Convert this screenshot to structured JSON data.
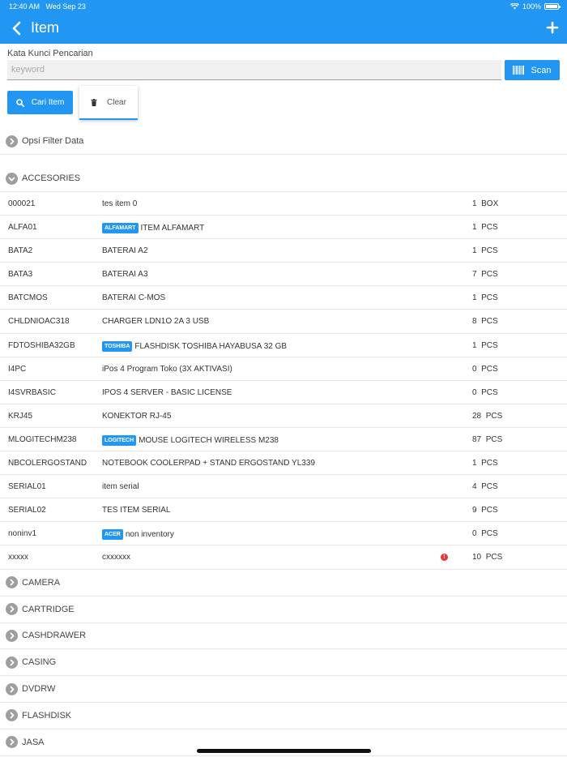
{
  "status_bar": {
    "time": "12:40 AM",
    "date": "Wed Sep 23",
    "battery": "100%",
    "battery_level": 1.0
  },
  "header": {
    "title": "Item",
    "back_icon": "chevron-left-icon",
    "add_icon": "plus-icon"
  },
  "search": {
    "label": "Kata Kunci Pencarian",
    "placeholder": "keyword",
    "value": "",
    "scan_label": "Scan"
  },
  "actions": {
    "search_label": "Cari Item",
    "clear_label": "Clear"
  },
  "filter": {
    "label": "Opsi Filter Data"
  },
  "expanded_group": {
    "name": "ACCESORIES",
    "items": [
      {
        "code": "000021",
        "brand": "",
        "name": "tes item 0",
        "qty": "1",
        "unit": "BOX",
        "warning": false
      },
      {
        "code": "ALFA01",
        "brand": "ALFAMART",
        "name": "ITEM ALFAMART",
        "qty": "1",
        "unit": "PCS",
        "warning": false
      },
      {
        "code": "BATA2",
        "brand": "",
        "name": "BATERAI A2",
        "qty": "1",
        "unit": "PCS",
        "warning": false
      },
      {
        "code": "BATA3",
        "brand": "",
        "name": "BATERAI A3",
        "qty": "7",
        "unit": "PCS",
        "warning": false
      },
      {
        "code": "BATCMOS",
        "brand": "",
        "name": "BATERAI C-MOS",
        "qty": "1",
        "unit": "PCS",
        "warning": false
      },
      {
        "code": "CHLDNIOAC318",
        "brand": "",
        "name": "CHARGER LDN1O 2A 3 USB",
        "qty": "8",
        "unit": "PCS",
        "warning": false
      },
      {
        "code": "FDTOSHIBA32GB",
        "brand": "TOSHIBA",
        "name": "FLASHDISK TOSHIBA HAYABUSA 32 GB",
        "qty": "1",
        "unit": "PCS",
        "warning": false
      },
      {
        "code": "I4PC",
        "brand": "",
        "name": "iPos 4 Program Toko (3X AKTIVASI)",
        "qty": "0",
        "unit": "PCS",
        "warning": false
      },
      {
        "code": "I4SVRBASIC",
        "brand": "",
        "name": "IPOS 4 SERVER - BASIC LICENSE",
        "qty": "0",
        "unit": "PCS",
        "warning": false
      },
      {
        "code": "KRJ45",
        "brand": "",
        "name": "KONEKTOR RJ-45",
        "qty": "28",
        "unit": "PCS",
        "warning": false
      },
      {
        "code": "MLOGITECHM238",
        "brand": "LOGITECH",
        "name": "MOUSE LOGITECH WIRELESS M238",
        "qty": "87",
        "unit": "PCS",
        "warning": false
      },
      {
        "code": "NBCOLERGOSTAND",
        "brand": "",
        "name": "NOTEBOOK COOLERPAD + STAND ERGOSTAND YL339",
        "qty": "1",
        "unit": "PCS",
        "warning": false
      },
      {
        "code": "SERIAL01",
        "brand": "",
        "name": "item serial",
        "qty": "4",
        "unit": "PCS",
        "warning": false
      },
      {
        "code": "SERIAL02",
        "brand": "",
        "name": "TES ITEM SERIAL",
        "qty": "9",
        "unit": "PCS",
        "warning": false
      },
      {
        "code": "noninv1",
        "brand": "ACER",
        "name": "non inventory",
        "qty": "0",
        "unit": "PCS",
        "warning": false
      },
      {
        "code": "xxxxx",
        "brand": "",
        "name": "cxxxxxx",
        "qty": "10",
        "unit": "PCS",
        "warning": true
      }
    ]
  },
  "collapsed_groups": [
    "CAMERA",
    "CARTRIDGE",
    "CASHDRAWER",
    "CASING",
    "DVDRW",
    "FLASHDISK",
    "JASA"
  ],
  "colors": {
    "primary": "#2196f3",
    "warning": "#e53935",
    "divider": "#e6e6e6",
    "chevron_circle": "#9e9e9e"
  }
}
